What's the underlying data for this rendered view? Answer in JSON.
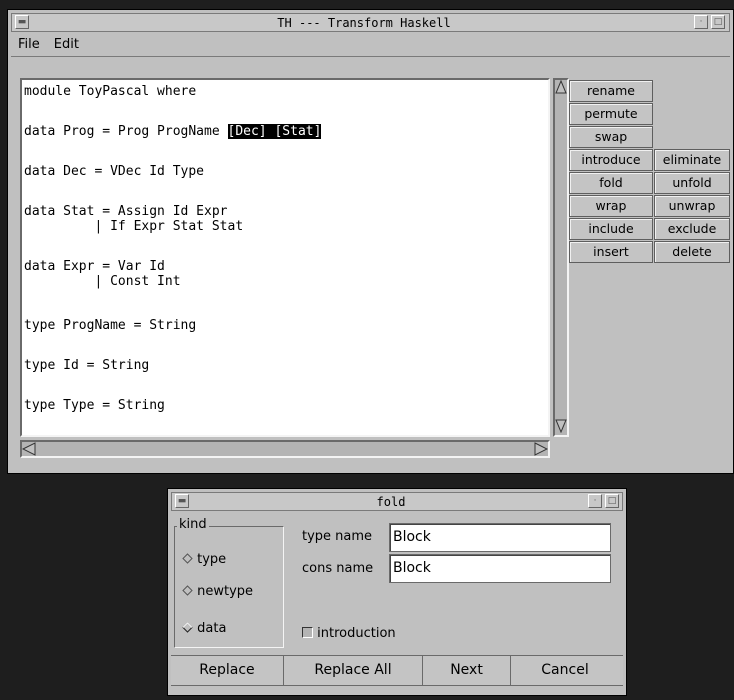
{
  "main_window": {
    "title": "TH --- Transform Haskell",
    "menu": [
      "File",
      "Edit"
    ],
    "code": [
      "module ToyPascal where",
      "data Prog = Prog ProgName ",
      "data Dec = VDec Id Type",
      "data Stat = Assign Id Expr",
      "         | If Expr Stat Stat",
      "data Expr = Var Id",
      "         | Const Int",
      "type ProgName = String",
      "type Id = String",
      "type Type = String"
    ],
    "highlight": "[Dec] [Stat]",
    "buttons_left": [
      "rename",
      "permute",
      "swap",
      "introduce",
      "fold",
      "wrap",
      "include",
      "insert"
    ],
    "buttons_right": [
      "eliminate",
      "unfold",
      "unwrap",
      "exclude",
      "delete"
    ]
  },
  "fold_dialog": {
    "title": "fold",
    "kind_label": "kind",
    "kind_options": [
      "type",
      "newtype",
      "data"
    ],
    "type_name_label": "type name",
    "type_name_value": "Block",
    "cons_name_label": "cons name",
    "cons_name_value": "Block",
    "introduction_label": "introduction",
    "buttons": [
      "Replace",
      "Replace All",
      "Next",
      "Cancel"
    ]
  }
}
